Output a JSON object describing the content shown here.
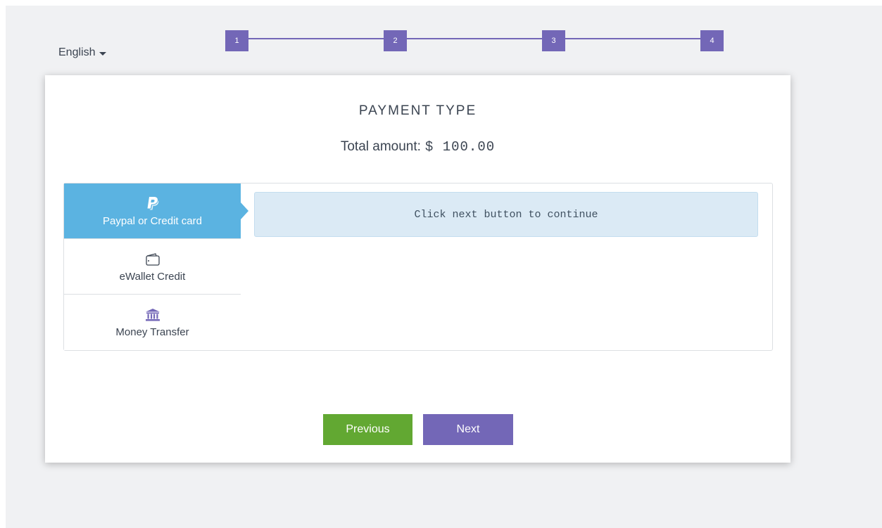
{
  "language": {
    "label": "English"
  },
  "stepper": {
    "steps": [
      "1",
      "2",
      "3",
      "4"
    ]
  },
  "payment": {
    "title": "PAYMENT TYPE",
    "total_label": "Total amount:",
    "total_value": "$ 100.00"
  },
  "methods": [
    {
      "label": "Paypal or Credit card",
      "icon": "paypal-icon",
      "active": true
    },
    {
      "label": "eWallet Credit",
      "icon": "wallet-icon",
      "active": false
    },
    {
      "label": "Money Transfer",
      "icon": "bank-icon",
      "active": false
    }
  ],
  "info_message": "Click next button to continue",
  "buttons": {
    "previous": "Previous",
    "next": "Next"
  },
  "colors": {
    "accent": "#7367b7",
    "active_tab": "#5bb3e1",
    "previous_button": "#62a832",
    "info_background": "#dbeaf5"
  }
}
